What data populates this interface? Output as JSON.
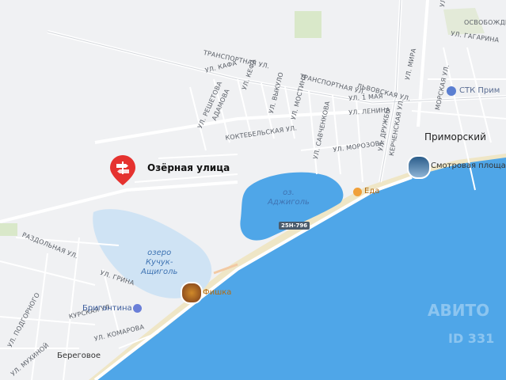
{
  "pin": {
    "title": "Озёрная улица",
    "icon": "signpost-pin-icon"
  },
  "settlements": {
    "primorsky": "Приморский",
    "beregovoe": "Береговое"
  },
  "lakes": {
    "adzhigol": [
      "оз.",
      "Аджиголь"
    ],
    "kuchuk": [
      "озеро",
      "Кучук-",
      "Ащиголь"
    ]
  },
  "road_shield": "25Н-796",
  "pois": {
    "viewpoint": "Смотровая площад",
    "food": "Еда",
    "fishka": "Фишка",
    "stk": "СТК Прим",
    "brigantina": "Бригантина"
  },
  "streets": {
    "transportnaya": "ТРАНСПОРТНАЯ УЛ.",
    "transportnaya2": "ТРАНСПОРТНАЯ УЛ.",
    "lvovskaya": "ЛЬВОВСКАЯ УЛ.",
    "kafa": "УЛ. КАФА",
    "kefa": "УЛ. КЕФА",
    "adamova": "АДАМОВА",
    "reshetova": "УЛ. РЕШЕТОВА",
    "mostina": "УЛ. МОСТИНА",
    "vykulo": "УЛ. ВЫКУЛО",
    "koktebelskaya": "КОКТЕБЕЛЬСКАЯ УЛ.",
    "savchenkova": "УЛ. САВЧЕНКОВА",
    "lenina": "УЛ. ЛЕНИНА",
    "morozova": "УЛ. МОРОЗОВА",
    "kerchenskaya": "КЕРЧЕНСКАЯ УЛ.",
    "mira": "УЛ. МИРА",
    "gagarina": "УЛ. ГАГАРИНА",
    "druzhby": "УЛ. ДРУЖБЫ",
    "pervogo_maya": "УЛ. 1 МАЯ",
    "morskaya": "МОРСКАЯ УЛ.",
    "osvobozhdeniya": "ОСВОБОЖДЕНИ",
    "razdolnaya": "РАЗДОЛЬНАЯ УЛ.",
    "grina": "УЛ. ГРИНА",
    "kurskaya": "КУРСКАЯ УЛ.",
    "komarova": "УЛ. КОМАРОВА",
    "podgornaya": "УЛ. ПОДГОРНОГО",
    "mukhinoi": "УЛ. МУХИНОЙ",
    "x1": "УЛ."
  },
  "watermark": "АВИТО",
  "watermark_id": "ID 331"
}
